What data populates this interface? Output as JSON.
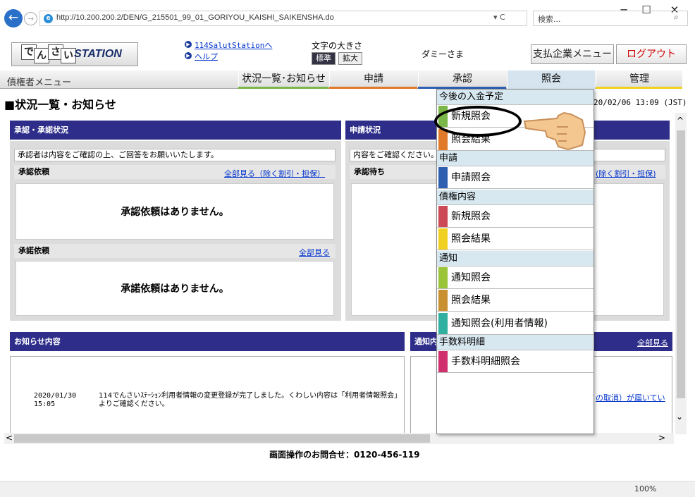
{
  "browser": {
    "url": "http://10.200.200.2/DEN/G_215501_99_01_GORIYOU_KAISHI_SAIKENSHA.do",
    "search_placeholder": "検索...",
    "zoom": "100%",
    "controls": "▾ C"
  },
  "header": {
    "logo": "STATION",
    "logo_kana": [
      "で",
      "ん",
      "さ",
      "い"
    ],
    "link1": "114SalutStationへ",
    "link2": "ヘルプ",
    "font_size_label": "文字の大きさ",
    "font_std": "標準",
    "font_big": "拡大",
    "username": "ダミーさま",
    "payer_menu": "支払企業メニュー",
    "logout": "ログアウト"
  },
  "nav": {
    "creditor_menu": "債権者メニュー",
    "tabs": [
      {
        "label": "状況一覧･お知らせ",
        "color": "#7ab648"
      },
      {
        "label": "申請",
        "color": "#e07a2a"
      },
      {
        "label": "承認",
        "color": "#2e5fb0"
      },
      {
        "label": "照会",
        "color": "#888888"
      },
      {
        "label": "管理",
        "color": "#f0d020"
      }
    ]
  },
  "page": {
    "title": "■状況一覧・お知らせ",
    "timestamp": "20/02/06 13:09 (JST)"
  },
  "approval": {
    "title": "承認・承諾状況",
    "note": "承認者は内容をご確認の上、ご回答をお願いいたします。",
    "sub1": "承認依頼",
    "sub1_link": "全部見る（除く割引・担保）",
    "empty1": "承認依頼はありません。",
    "sub2": "承諾依頼",
    "sub2_link": "全部見る",
    "empty2": "承諾依頼はありません。"
  },
  "application": {
    "title": "申請状況",
    "note": "内容をご確認ください。",
    "sub1": "承認待ち",
    "sub1_link": "(除く割引・担保)"
  },
  "news": {
    "title": "お知らせ内容",
    "date": "2020/01/30",
    "time": "15:05",
    "text": "114でんさいｽﾃｰｼｮﾝ利用者情報の変更登録が完了しました。くわしい内容は「利用者情報照会」よりご確認ください。"
  },
  "notice": {
    "title": "通知内",
    "link": "全部見る",
    "row_text": "の取消）が届いてい"
  },
  "footer": {
    "contact": "画面操作のお問合せ：0120-456-119"
  },
  "dropdown": {
    "sections": [
      {
        "header": "今後の入金予定",
        "items": [
          {
            "label": "新規照会",
            "color": "#7ab648"
          },
          {
            "label": "照会結果",
            "color": "#e07a2a"
          }
        ]
      },
      {
        "header": "申請",
        "items": [
          {
            "label": "申請照会",
            "color": "#2e5fb0"
          }
        ]
      },
      {
        "header": "債権内容",
        "items": [
          {
            "label": "新規照会",
            "color": "#cc4a55"
          },
          {
            "label": "照会結果",
            "color": "#f0d020"
          }
        ]
      },
      {
        "header": "通知",
        "items": [
          {
            "label": "通知照会",
            "color": "#9ac43a"
          },
          {
            "label": "照会結果",
            "color": "#c89030"
          },
          {
            "label": "通知照会(利用者情報)",
            "color": "#2fb0a0"
          }
        ]
      },
      {
        "header": "手数料明細",
        "items": [
          {
            "label": "手数料明細照会",
            "color": "#d0306e"
          }
        ]
      }
    ]
  }
}
